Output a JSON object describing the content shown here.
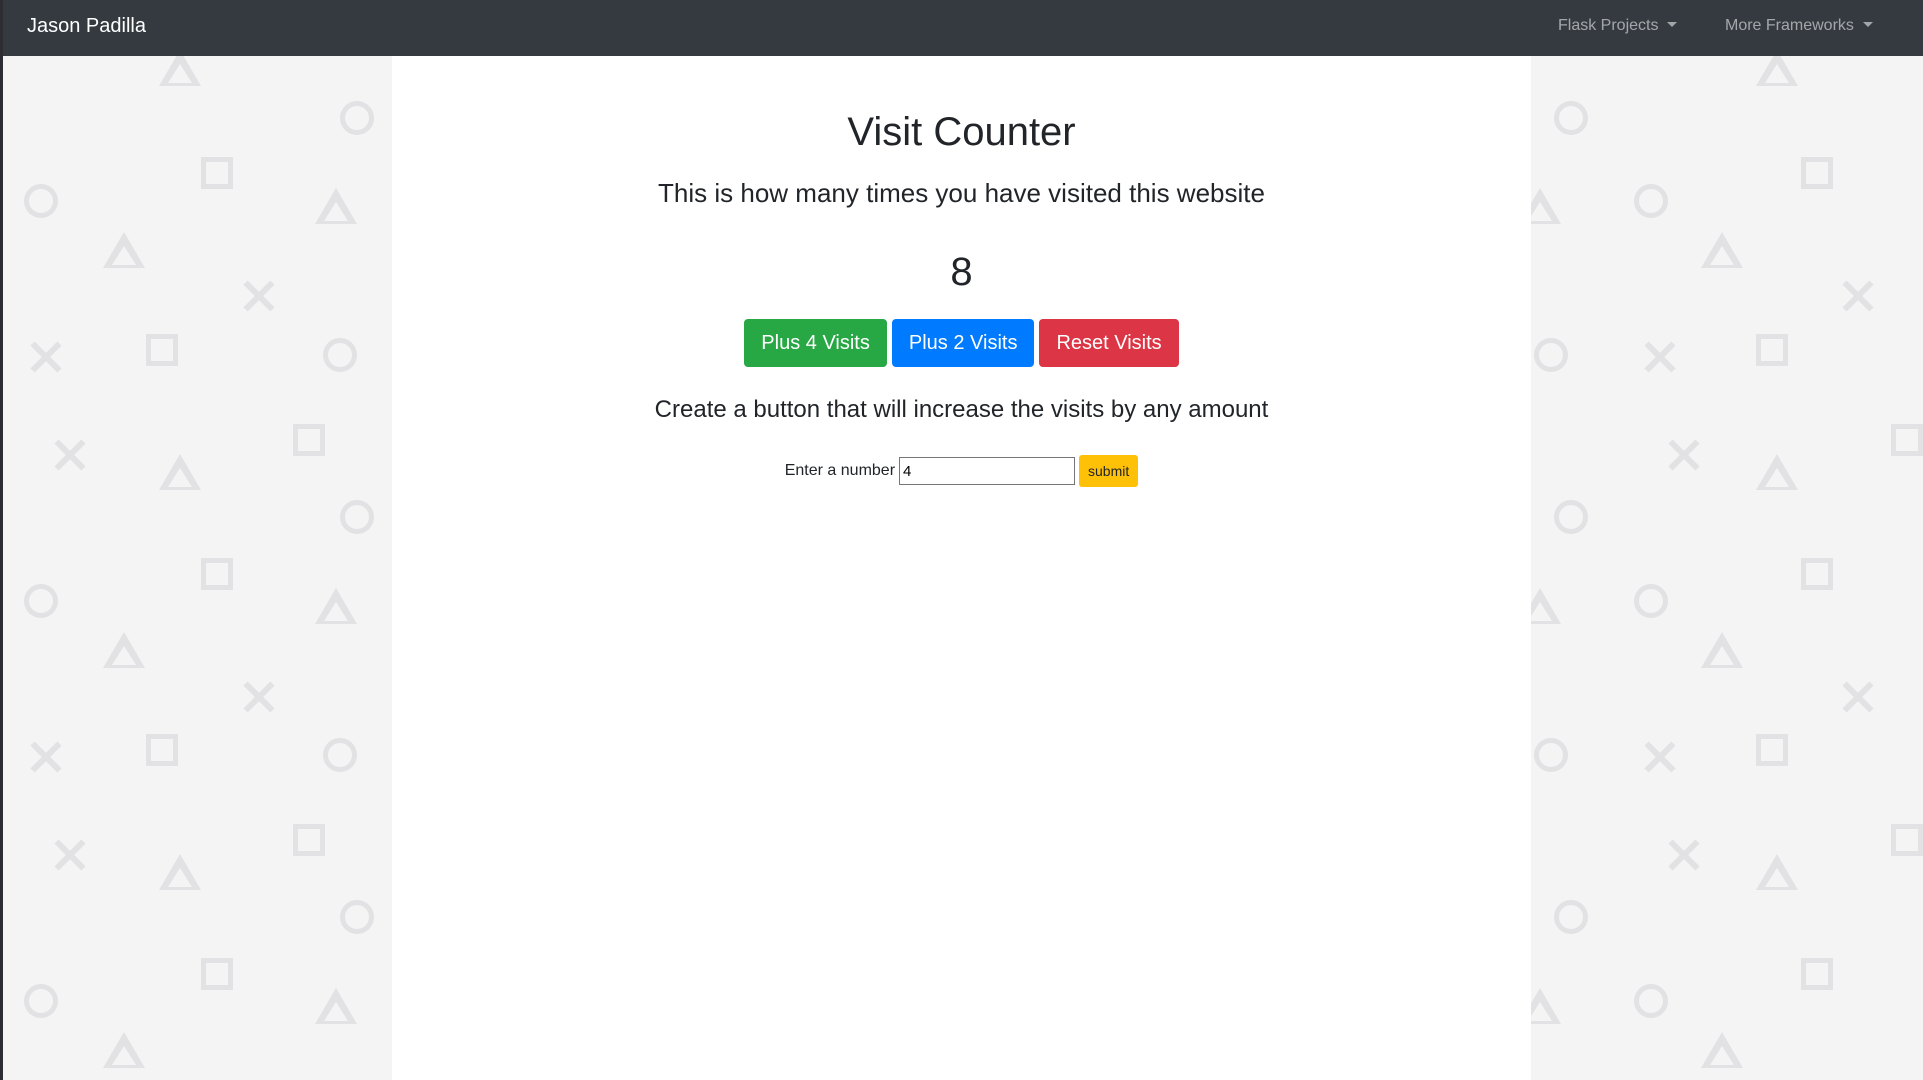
{
  "navbar": {
    "brand": "Jason Padilla",
    "items": [
      {
        "label": "Flask Projects"
      },
      {
        "label": "More Frameworks"
      }
    ]
  },
  "main": {
    "title": "Visit Counter",
    "subtitle": "This is how many times you have visited this website",
    "count": "8",
    "buttons": [
      {
        "label": "Plus 4 Visits",
        "color": "#28a745"
      },
      {
        "label": "Plus 2 Visits",
        "color": "#007bff"
      },
      {
        "label": "Reset Visits",
        "color": "#dc3545"
      }
    ],
    "form": {
      "heading": "Create a button that will increase the visits by any amount",
      "label": "Enter a number",
      "value": "4",
      "submit_label": "submit"
    }
  },
  "colors": {
    "navbar": "#343a40",
    "page_background": "#f4f4f5",
    "content_background": "#ffffff",
    "submit": "#ffc107"
  }
}
